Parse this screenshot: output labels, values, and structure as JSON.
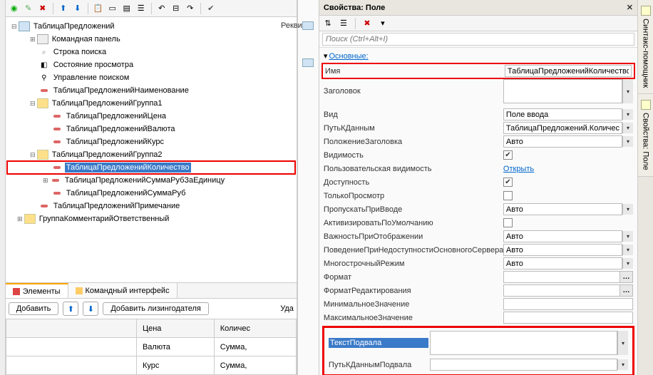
{
  "props_title": "Свойства: Поле",
  "search_placeholder": "Поиск (Ctrl+Alt+I)",
  "section_main": "Основные:",
  "tree": {
    "root": "ТаблицаПредложений",
    "cmd_panel": "Командная панель",
    "search_row": "Строка поиска",
    "view_state": "Состояние просмотра",
    "search_ctrl": "Управление поиском",
    "name_field": "ТаблицаПредложенийНаименование",
    "group1": "ТаблицаПредложенийГруппа1",
    "price": "ТаблицаПредложенийЦена",
    "currency": "ТаблицаПредложенийВалюта",
    "rate": "ТаблицаПредложенийКурс",
    "group2": "ТаблицаПредложенийГруппа2",
    "qty": "ТаблицаПредложенийКоличество",
    "sum_unit": "ТаблицаПредложенийСуммаРубЗаЕдиницу",
    "sum_rub": "ТаблицаПредложенийСуммаРуб",
    "note": "ТаблицаПредложенийПримечание",
    "group_comment": "ГруппаКомментарийОтветственный"
  },
  "tabs": {
    "elements": "Элементы",
    "cmd_iface": "Командный интерфейс"
  },
  "buttons": {
    "add": "Добавить",
    "add_lessor": "Добавить лизингодателя",
    "delete": "Уда"
  },
  "rekvi": "Рекви",
  "grid": {
    "col1": "Цена",
    "col2": "Количес",
    "r1c1": "Валюта",
    "r1c2": "Сумма,",
    "r2c1": "Курс",
    "r2c2": "Сумма,"
  },
  "props": {
    "name_l": "Имя",
    "name_v": "ТаблицаПредложенийКоличество",
    "header_l": "Заголовок",
    "kind_l": "Вид",
    "kind_v": "Поле ввода",
    "datapath_l": "ПутьКДанным",
    "datapath_v": "ТаблицаПредложений.Количес",
    "hdrpos_l": "ПоложениеЗаголовка",
    "hdrpos_v": "Авто",
    "vis_l": "Видимость",
    "uservis_l": "Пользовательская видимость",
    "uservis_v": "Открыть",
    "avail_l": "Доступность",
    "readonly_l": "ТолькоПросмотр",
    "skip_l": "ПропускатьПриВводе",
    "skip_v": "Авто",
    "activate_l": "АктивизироватьПоУмолчанию",
    "importance_l": "ВажностьПриОтображении",
    "importance_v": "Авто",
    "behavior_l": "ПоведениеПриНедоступностиОсновногоСервера",
    "behavior_v": "Авто",
    "multiline_l": "МногострочныйРежим",
    "multiline_v": "Авто",
    "format_l": "Формат",
    "fmtedit_l": "ФорматРедактирования",
    "min_l": "МинимальноеЗначение",
    "max_l": "МаксимальноеЗначение",
    "footer_text_l": "ТекстПодвала",
    "footer_path_l": "ПутьКДаннымПодвала"
  },
  "side": {
    "syntax": "Синтакс-помощник",
    "props": "Свойства: Поле"
  }
}
